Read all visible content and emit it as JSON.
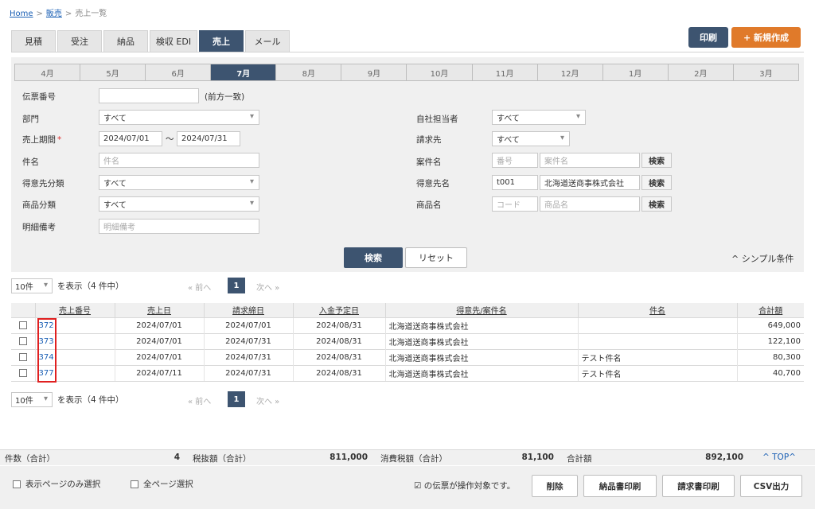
{
  "breadcrumb": {
    "home": "Home",
    "sales": "販売",
    "current": "売上一覧",
    "sep": ">"
  },
  "tabs": [
    "見積",
    "受注",
    "納品",
    "検収 EDI",
    "売上",
    "メール"
  ],
  "active_tab": "売上",
  "actions": {
    "print": "印刷",
    "new": "+ 新規作成"
  },
  "months": [
    "4月",
    "5月",
    "6月",
    "7月",
    "8月",
    "9月",
    "10月",
    "11月",
    "12月",
    "1月",
    "2月",
    "3月"
  ],
  "form": {
    "slip_no_label": "伝票番号",
    "slip_no_hint": "(前方一致)",
    "dept_label": "部門",
    "dept_value": "すべて",
    "period_label": "売上期間",
    "required_mark": "*",
    "period_from": "2024/07/01",
    "period_tilde": "〜",
    "period_to": "2024/07/31",
    "subject_label": "件名",
    "subject_placeholder": "件名",
    "cust_cat_label": "得意先分類",
    "cust_cat_value": "すべて",
    "prod_cat_label": "商品分類",
    "prod_cat_value": "すべて",
    "detail_note_label": "明細備考",
    "detail_note_placeholder": "明細備考",
    "staff_label": "自社担当者",
    "staff_value": "すべて",
    "billing_label": "請求先",
    "billing_value": "すべて",
    "project_label": "案件名",
    "project_no_placeholder": "番号",
    "project_name_placeholder": "案件名",
    "customer_label": "得意先名",
    "customer_code": "t001",
    "customer_name": "北海道送商事株式会社",
    "product_label": "商品名",
    "product_code_placeholder": "コード",
    "product_name_placeholder": "商品名",
    "search_small": "検索"
  },
  "search_button": "検索",
  "reset_button": "リセット",
  "simple_toggle": "^ シンプル条件",
  "pager": {
    "per_page": "10件",
    "text": "を表示（4 件中）",
    "prev": "« 前へ",
    "page": "1",
    "next": "次へ »"
  },
  "table": {
    "headers": [
      "売上番号",
      "売上日",
      "請求締日",
      "入金予定日",
      "得意先/案件名",
      "件名",
      "合計額"
    ],
    "rows": [
      {
        "id": "372",
        "date": "2024/07/01",
        "close": "2024/07/01",
        "due": "2024/08/31",
        "customer": "北海道送商事株式会社",
        "subject": "",
        "total": "649,000"
      },
      {
        "id": "373",
        "date": "2024/07/01",
        "close": "2024/07/31",
        "due": "2024/08/31",
        "customer": "北海道送商事株式会社",
        "subject": "",
        "total": "122,100"
      },
      {
        "id": "374",
        "date": "2024/07/01",
        "close": "2024/07/31",
        "due": "2024/08/31",
        "customer": "北海道送商事株式会社",
        "subject": "テスト件名",
        "total": "80,300"
      },
      {
        "id": "377",
        "date": "2024/07/11",
        "close": "2024/07/31",
        "due": "2024/08/31",
        "customer": "北海道送商事株式会社",
        "subject": "テスト件名",
        "total": "40,700"
      }
    ]
  },
  "totals": {
    "count_label": "件数（合計）",
    "count": "4",
    "pretax_label": "税抜額（合計）",
    "pretax": "811,000",
    "tax_label": "消費税額（合計）",
    "tax": "81,100",
    "total_label": "合計額",
    "total": "892,100",
    "top_link": "^ TOP^"
  },
  "footer": {
    "page_only": "表示ページのみ選択",
    "all_pages": "全ページ選択",
    "note": "☑ の伝票が操作対象です。",
    "delete": "削除",
    "delivery_print": "納品書印刷",
    "invoice_print": "請求書印刷",
    "csv": "CSV出力"
  }
}
